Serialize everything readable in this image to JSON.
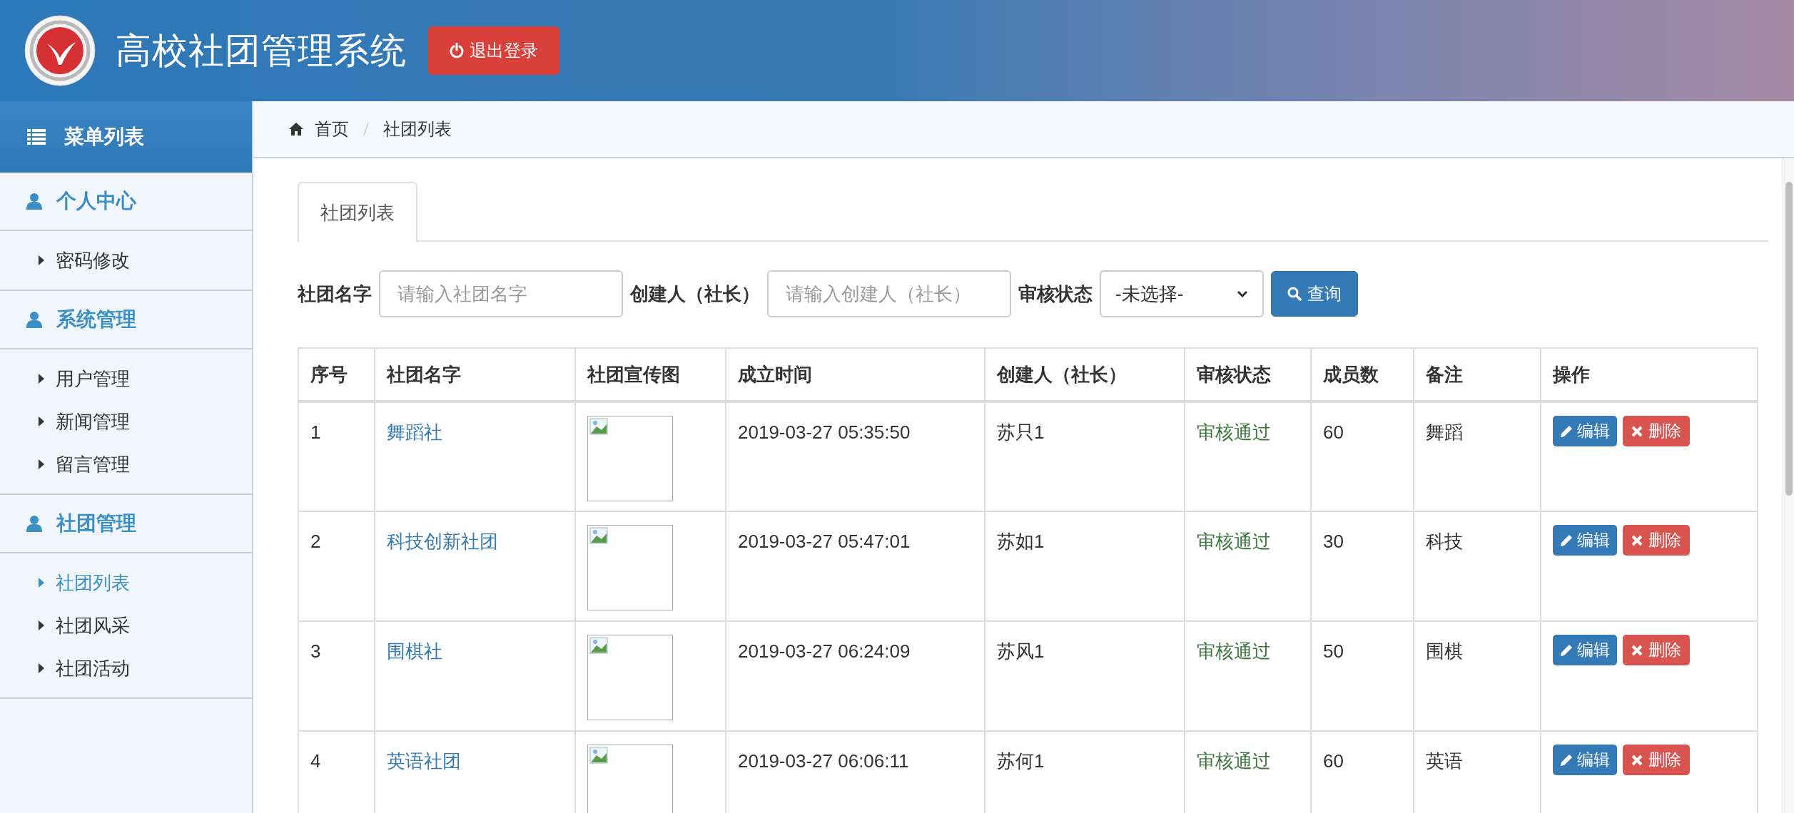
{
  "header": {
    "title": "高校社团管理系统",
    "logout_button": "退出登录"
  },
  "sidebar": {
    "title": "菜单列表",
    "groups": [
      {
        "label": "个人中心",
        "items": [
          {
            "label": "密码修改",
            "selected": false
          }
        ]
      },
      {
        "label": "系统管理",
        "items": [
          {
            "label": "用户管理",
            "selected": false
          },
          {
            "label": "新闻管理",
            "selected": false
          },
          {
            "label": "留言管理",
            "selected": false
          }
        ]
      },
      {
        "label": "社团管理",
        "items": [
          {
            "label": "社团列表",
            "selected": true
          },
          {
            "label": "社团风采",
            "selected": false
          },
          {
            "label": "社团活动",
            "selected": false
          }
        ]
      }
    ]
  },
  "breadcrumb": [
    "首页",
    "社团列表"
  ],
  "tabs": [
    {
      "label": "社团列表",
      "selected": true
    }
  ],
  "filters": [
    {
      "kind": "text",
      "label": "社团名字",
      "placeholder": "请输入社团名字"
    },
    {
      "kind": "text",
      "label": "创建人（社长）",
      "placeholder": "请输入创建人（社长）"
    },
    {
      "kind": "select",
      "label": "审核状态",
      "value": "-未选择-"
    }
  ],
  "search_button": "查询",
  "table": {
    "columns": [
      "序号",
      "社团名字",
      "社团宣传图",
      "成立时间",
      "创建人（社长）",
      "审核状态",
      "成员数",
      "备注",
      "操作"
    ],
    "rows": [
      {
        "index": "1",
        "name": "舞蹈社",
        "founded": "2019-03-27 05:35:50",
        "creator": "苏只1",
        "status": "审核通过",
        "members": "60",
        "note": "舞蹈",
        "edit": "编辑",
        "delete": "删除"
      },
      {
        "index": "2",
        "name": "科技创新社团",
        "founded": "2019-03-27 05:47:01",
        "creator": "苏如1",
        "status": "审核通过",
        "members": "30",
        "note": "科技",
        "edit": "编辑",
        "delete": "删除"
      },
      {
        "index": "3",
        "name": "围棋社",
        "founded": "2019-03-27 06:24:09",
        "creator": "苏风1",
        "status": "审核通过",
        "members": "50",
        "note": "围棋",
        "edit": "编辑",
        "delete": "删除"
      },
      {
        "index": "4",
        "name": "英语社团",
        "founded": "2019-03-27 06:06:11",
        "creator": "苏何1",
        "status": "审核通过",
        "members": "60",
        "note": "英语",
        "edit": "编辑",
        "delete": "删除"
      }
    ]
  }
}
